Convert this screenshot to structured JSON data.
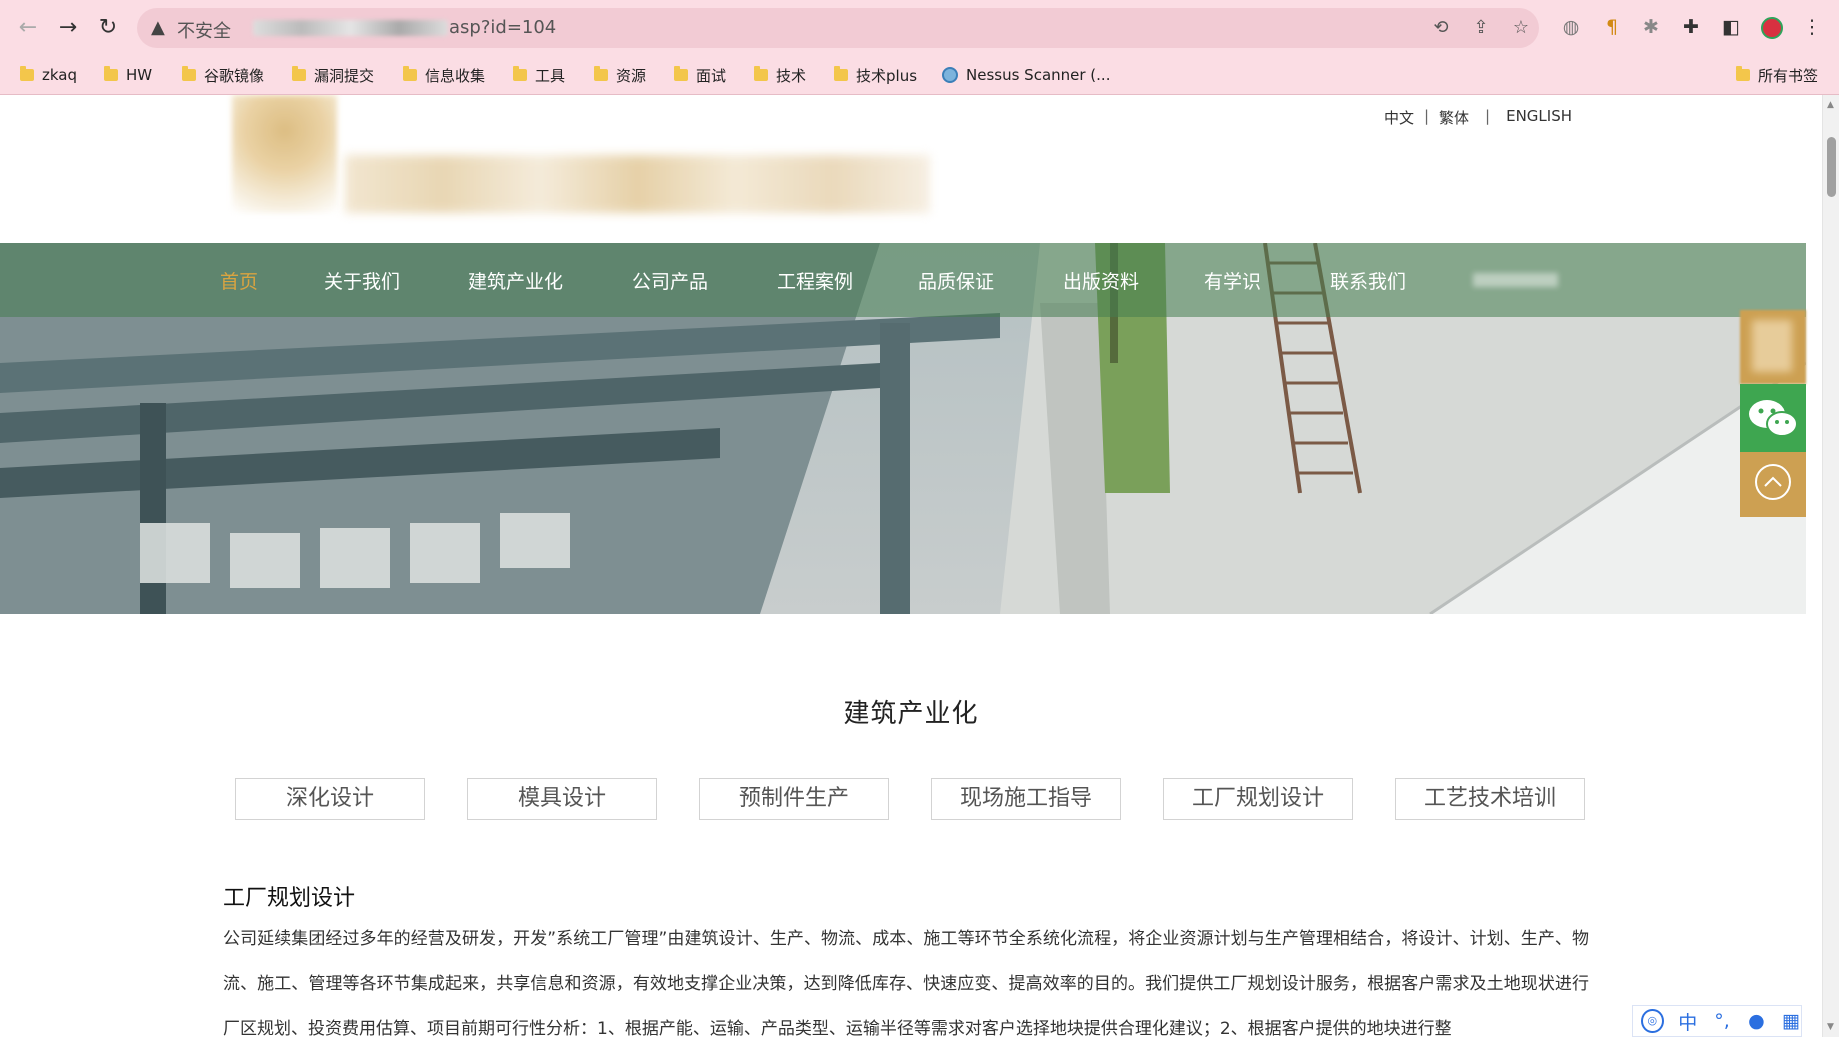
{
  "browser": {
    "insecure_label": "不安全",
    "url_suffix": "asp?id=104",
    "bookmarks": [
      {
        "label": "zkaq"
      },
      {
        "label": "HW"
      },
      {
        "label": "谷歌镜像"
      },
      {
        "label": "漏洞提交"
      },
      {
        "label": "信息收集"
      },
      {
        "label": "工具"
      },
      {
        "label": "资源"
      },
      {
        "label": "面试"
      },
      {
        "label": "技术"
      },
      {
        "label": "技术plus"
      },
      {
        "label": "Nessus Scanner (..."
      }
    ],
    "all_bookmarks": "所有书签"
  },
  "header": {
    "lang": {
      "zh": "中文",
      "tw": "繁体",
      "en": "ENGLISH",
      "sep": "|"
    }
  },
  "nav": {
    "items": [
      "首页",
      "关于我们",
      "建筑产业化",
      "公司产品",
      "工程案例",
      "品质保证",
      "出版资料",
      "有学识",
      "联系我们"
    ],
    "active_color": "#d9a441"
  },
  "main": {
    "section_title": "建筑产业化",
    "tabs": [
      "深化设计",
      "模具设计",
      "预制件生产",
      "现场施工指导",
      "工厂规划设计",
      "工艺技术培训"
    ],
    "sub_title": "工厂规划设计",
    "body": "公司延续集团经过多年的经营及研发，开发”系统工厂管理”由建筑设计、生产、物流、成本、施工等环节全系统化流程，将企业资源计划与生产管理相结合，将设计、计划、生产、物流、施工、管理等各环节集成起来，共享信息和资源，有效地支撑企业决策，达到降低库存、快速应变、提高效率的目的。我们提供工厂规划设计服务，根据客户需求及土地现状进行厂区规划、投资费用估算、项目前期可行性分析：1、根据产能、运输、产品类型、运输半径等需求对客户选择地块提供合理化建议；2、根据客户提供的地块进行整"
  },
  "ime": {
    "zh": "中"
  }
}
